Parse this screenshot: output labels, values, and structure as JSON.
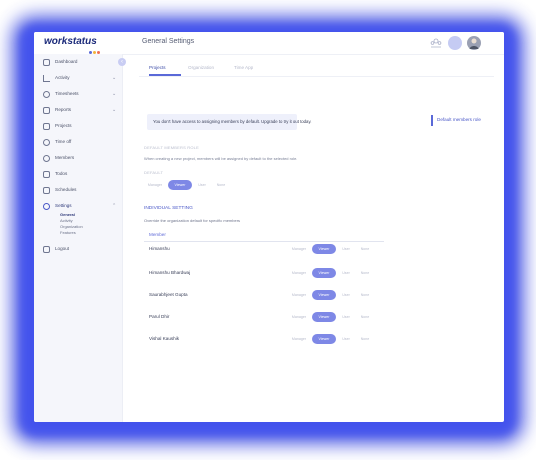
{
  "app": {
    "logo": "workstatus",
    "logo_dots": [
      "#5a69d8",
      "#f2b33d",
      "#ef6f53"
    ],
    "page_title": "General Settings"
  },
  "topbar_icons": [
    "team-icon",
    "user-avatar-placeholder",
    "user-avatar"
  ],
  "sidebar": {
    "items": [
      {
        "label": "Dashboard",
        "icon": "dashboard-icon",
        "chevron": false
      },
      {
        "label": "Activity",
        "icon": "activity-icon",
        "chevron": true
      },
      {
        "label": "Timesheets",
        "icon": "clock-icon",
        "chevron": true
      },
      {
        "label": "Reports",
        "icon": "reports-icon",
        "chevron": true
      },
      {
        "label": "Projects",
        "icon": "projects-icon",
        "chevron": false
      },
      {
        "label": "Time off",
        "icon": "time-off-icon",
        "chevron": false
      },
      {
        "label": "Members",
        "icon": "members-icon",
        "chevron": false
      },
      {
        "label": "Todos",
        "icon": "todos-icon",
        "chevron": false
      },
      {
        "label": "Schedules",
        "icon": "calendar-icon",
        "chevron": false
      },
      {
        "label": "Settings",
        "icon": "gear-icon",
        "chevron": true
      },
      {
        "label": "Logout",
        "icon": "logout-icon",
        "chevron": false
      }
    ],
    "settings_sub": [
      "General",
      "Activity",
      "Organization",
      "Features"
    ]
  },
  "tabs": [
    "Projects",
    "Organization",
    "Time App"
  ],
  "notice": "You don't have access to assigning members by default. Upgrade to try it out today.",
  "role_link": "Default members role",
  "default_heading": "DEFAULT MEMBERS ROLE",
  "default_desc": "When creating a new project, members will be assigned by default to the selected role.",
  "default_label": "DEFAULT",
  "role_options": [
    "Manager",
    "Viewer",
    "User",
    "None"
  ],
  "selected_role": "Viewer",
  "individual": {
    "title": "INDIVIDUAL SETTING",
    "desc": "Override the organization default for specific members",
    "column": "Member",
    "members": [
      {
        "name": "Himanshu",
        "role": "Viewer"
      },
      {
        "name": "Himanshu Bhardwaj",
        "role": "Viewer"
      },
      {
        "name": "Saurabhjeet Gupta",
        "role": "Viewer"
      },
      {
        "name": "Parul Dhir",
        "role": "Viewer"
      },
      {
        "name": "Vishal Kaushik",
        "role": "Viewer"
      }
    ]
  }
}
